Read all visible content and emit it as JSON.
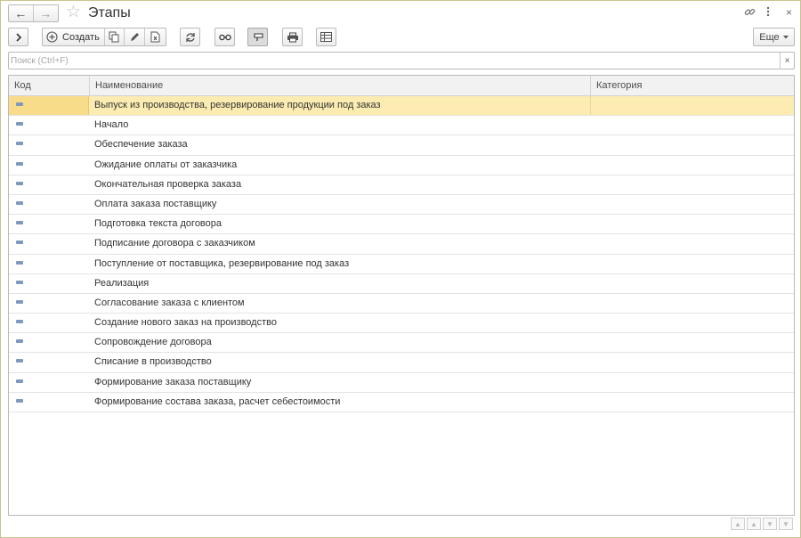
{
  "window": {
    "title": "Этапы"
  },
  "toolbar": {
    "create_label": "Создать",
    "more_label": "Еще"
  },
  "search": {
    "placeholder": "Поиск (Ctrl+F)",
    "value": ""
  },
  "table": {
    "columns": [
      "Код",
      "Наименование",
      "Категория"
    ],
    "rows": [
      {
        "code": "",
        "name": "Выпуск из производства, резервирование продукции под заказ",
        "category": "",
        "selected": true
      },
      {
        "code": "",
        "name": "Начало",
        "category": ""
      },
      {
        "code": "",
        "name": "Обеспечение заказа",
        "category": ""
      },
      {
        "code": "",
        "name": "Ожидание оплаты от заказчика",
        "category": ""
      },
      {
        "code": "",
        "name": "Окончательная проверка заказа",
        "category": ""
      },
      {
        "code": "",
        "name": "Оплата заказа поставщику",
        "category": ""
      },
      {
        "code": "",
        "name": "Подготовка текста договора",
        "category": ""
      },
      {
        "code": "",
        "name": "Подписание договора с заказчиком",
        "category": ""
      },
      {
        "code": "",
        "name": "Поступление от поставщика, резервирование под заказ",
        "category": ""
      },
      {
        "code": "",
        "name": "Реализация",
        "category": ""
      },
      {
        "code": "",
        "name": "Согласование заказа с клиентом",
        "category": ""
      },
      {
        "code": "",
        "name": "Создание нового заказ на производство",
        "category": ""
      },
      {
        "code": "",
        "name": "Сопровождение договора",
        "category": ""
      },
      {
        "code": "",
        "name": "Списание в производство",
        "category": ""
      },
      {
        "code": "",
        "name": "Формирование заказа поставщику",
        "category": ""
      },
      {
        "code": "",
        "name": "Формирование состава заказа, расчет себестоимости",
        "category": ""
      }
    ]
  },
  "colors": {
    "selected_row": "#fcecb1",
    "selected_cell": "#f8dc8a",
    "window_border": "#c9c38e",
    "item_icon": "#7f98bd"
  },
  "icons": {
    "back": "arrow-left-icon",
    "forward": "arrow-right-icon",
    "favorite": "star-icon",
    "link": "link-icon",
    "menu": "more-vertical-icon",
    "close": "close-icon",
    "row": "catalog-item-icon"
  }
}
